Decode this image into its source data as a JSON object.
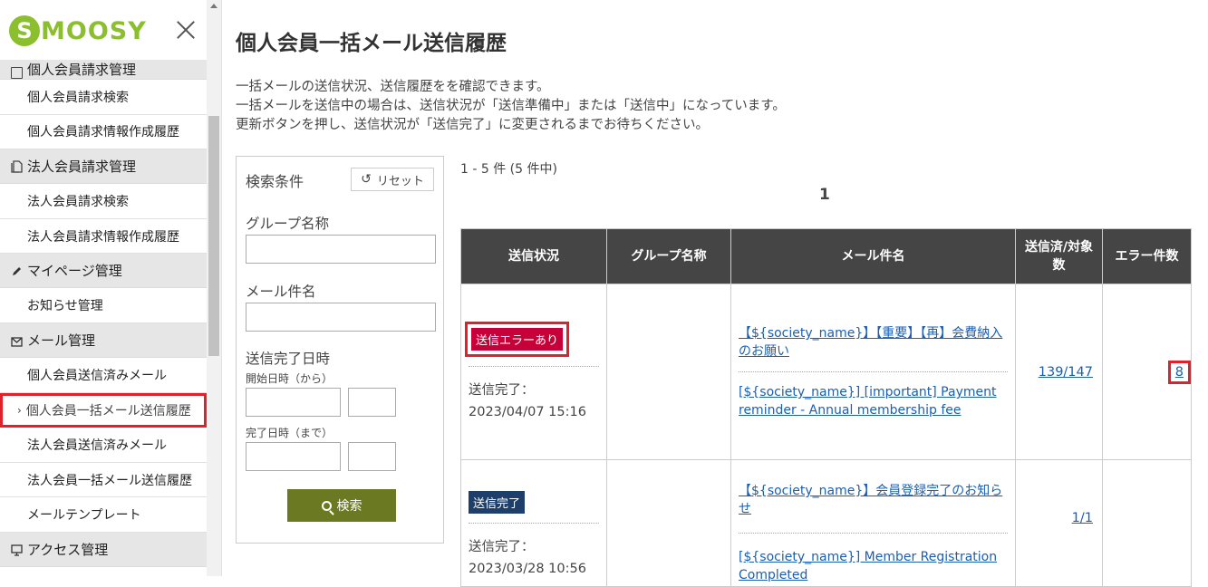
{
  "app": {
    "logo_initial": "S",
    "logo_rest": "MOOSY"
  },
  "sidebar": {
    "partial_section": "個人会員請求管理",
    "sections": [
      {
        "label": "法人会員請求管理"
      },
      {
        "label": "マイページ管理"
      },
      {
        "label": "メール管理"
      },
      {
        "label": "アクセス管理"
      }
    ],
    "items": [
      {
        "label": "個人会員請求検索"
      },
      {
        "label": "個人会員請求情報作成履歴"
      },
      {
        "label": "法人会員請求検索"
      },
      {
        "label": "法人会員請求情報作成履歴"
      },
      {
        "label": "お知らせ管理"
      },
      {
        "label": "個人会員送信済みメール"
      },
      {
        "label": "個人会員一括メール送信履歴",
        "chevron": "›"
      },
      {
        "label": "法人会員送信済みメール"
      },
      {
        "label": "法人会員一括メール送信履歴"
      },
      {
        "label": "メールテンプレート"
      }
    ]
  },
  "page": {
    "title": "個人会員一括メール送信履歴",
    "description": [
      "一括メールの送信状況、送信履歴をを確認できます。",
      "一括メールを送信中の場合は、送信状況が「送信準備中」または「送信中」になっています。",
      "更新ボタンを押し、送信状況が「送信完了」に変更されるまでお待ちください。"
    ]
  },
  "search": {
    "title": "検索条件",
    "reset_label": "リセット",
    "group_label": "グループ名称",
    "subject_label": "メール件名",
    "completed_label": "送信完了日時",
    "start_label": "開始日時（から）",
    "end_label": "完了日時（まで）",
    "search_label": "検索"
  },
  "results": {
    "count_text": "1 - 5 件 (5 件中)",
    "page": "1",
    "headers": [
      "送信状況",
      "グループ名称",
      "メール件名",
      "送信済/対象数",
      "エラー件数"
    ],
    "rows": [
      {
        "badge": "送信エラーあり",
        "status_label": "送信完了：",
        "status_time": "2023/04/07 15:16",
        "group": "",
        "subject_ja": "【${society_name}】【重要】【再】会費納入のお願い",
        "subject_en": "[${society_name}] [important] Payment reminder - Annual membership fee",
        "sent": "139/147",
        "errors": "8"
      },
      {
        "badge": "送信完了",
        "status_label": "送信完了：",
        "status_time": "2023/03/28 10:56",
        "group": "",
        "subject_ja": "【${society_name}】会員登録完了のお知らせ",
        "subject_en": "[${society_name}] Member Registration Completed",
        "sent": "1/1",
        "errors": ""
      }
    ]
  },
  "colors": {
    "brand": "#8bbf2d",
    "header_bg": "#454545",
    "error_badge": "#c8003a",
    "done_badge": "#1e3f6a",
    "search_button": "#6b7a22",
    "highlight": "#e0202a"
  }
}
